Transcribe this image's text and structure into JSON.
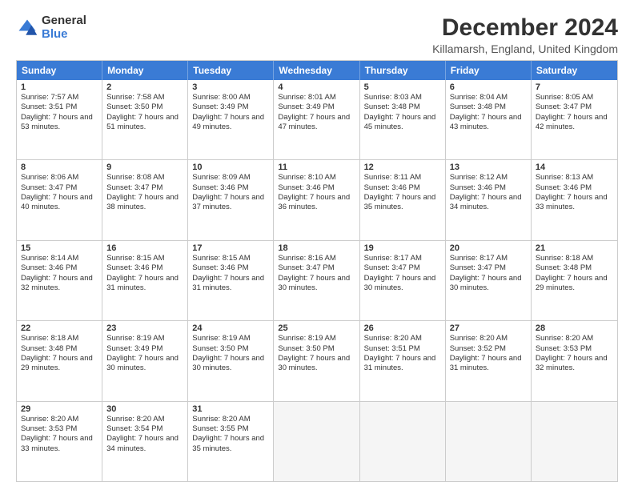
{
  "logo": {
    "general": "General",
    "blue": "Blue"
  },
  "title": "December 2024",
  "subtitle": "Killamarsh, England, United Kingdom",
  "header_days": [
    "Sunday",
    "Monday",
    "Tuesday",
    "Wednesday",
    "Thursday",
    "Friday",
    "Saturday"
  ],
  "weeks": [
    [
      {
        "day": "1",
        "sunrise": "Sunrise: 7:57 AM",
        "sunset": "Sunset: 3:51 PM",
        "daylight": "Daylight: 7 hours and 53 minutes."
      },
      {
        "day": "2",
        "sunrise": "Sunrise: 7:58 AM",
        "sunset": "Sunset: 3:50 PM",
        "daylight": "Daylight: 7 hours and 51 minutes."
      },
      {
        "day": "3",
        "sunrise": "Sunrise: 8:00 AM",
        "sunset": "Sunset: 3:49 PM",
        "daylight": "Daylight: 7 hours and 49 minutes."
      },
      {
        "day": "4",
        "sunrise": "Sunrise: 8:01 AM",
        "sunset": "Sunset: 3:49 PM",
        "daylight": "Daylight: 7 hours and 47 minutes."
      },
      {
        "day": "5",
        "sunrise": "Sunrise: 8:03 AM",
        "sunset": "Sunset: 3:48 PM",
        "daylight": "Daylight: 7 hours and 45 minutes."
      },
      {
        "day": "6",
        "sunrise": "Sunrise: 8:04 AM",
        "sunset": "Sunset: 3:48 PM",
        "daylight": "Daylight: 7 hours and 43 minutes."
      },
      {
        "day": "7",
        "sunrise": "Sunrise: 8:05 AM",
        "sunset": "Sunset: 3:47 PM",
        "daylight": "Daylight: 7 hours and 42 minutes."
      }
    ],
    [
      {
        "day": "8",
        "sunrise": "Sunrise: 8:06 AM",
        "sunset": "Sunset: 3:47 PM",
        "daylight": "Daylight: 7 hours and 40 minutes."
      },
      {
        "day": "9",
        "sunrise": "Sunrise: 8:08 AM",
        "sunset": "Sunset: 3:47 PM",
        "daylight": "Daylight: 7 hours and 38 minutes."
      },
      {
        "day": "10",
        "sunrise": "Sunrise: 8:09 AM",
        "sunset": "Sunset: 3:46 PM",
        "daylight": "Daylight: 7 hours and 37 minutes."
      },
      {
        "day": "11",
        "sunrise": "Sunrise: 8:10 AM",
        "sunset": "Sunset: 3:46 PM",
        "daylight": "Daylight: 7 hours and 36 minutes."
      },
      {
        "day": "12",
        "sunrise": "Sunrise: 8:11 AM",
        "sunset": "Sunset: 3:46 PM",
        "daylight": "Daylight: 7 hours and 35 minutes."
      },
      {
        "day": "13",
        "sunrise": "Sunrise: 8:12 AM",
        "sunset": "Sunset: 3:46 PM",
        "daylight": "Daylight: 7 hours and 34 minutes."
      },
      {
        "day": "14",
        "sunrise": "Sunrise: 8:13 AM",
        "sunset": "Sunset: 3:46 PM",
        "daylight": "Daylight: 7 hours and 33 minutes."
      }
    ],
    [
      {
        "day": "15",
        "sunrise": "Sunrise: 8:14 AM",
        "sunset": "Sunset: 3:46 PM",
        "daylight": "Daylight: 7 hours and 32 minutes."
      },
      {
        "day": "16",
        "sunrise": "Sunrise: 8:15 AM",
        "sunset": "Sunset: 3:46 PM",
        "daylight": "Daylight: 7 hours and 31 minutes."
      },
      {
        "day": "17",
        "sunrise": "Sunrise: 8:15 AM",
        "sunset": "Sunset: 3:46 PM",
        "daylight": "Daylight: 7 hours and 31 minutes."
      },
      {
        "day": "18",
        "sunrise": "Sunrise: 8:16 AM",
        "sunset": "Sunset: 3:47 PM",
        "daylight": "Daylight: 7 hours and 30 minutes."
      },
      {
        "day": "19",
        "sunrise": "Sunrise: 8:17 AM",
        "sunset": "Sunset: 3:47 PM",
        "daylight": "Daylight: 7 hours and 30 minutes."
      },
      {
        "day": "20",
        "sunrise": "Sunrise: 8:17 AM",
        "sunset": "Sunset: 3:47 PM",
        "daylight": "Daylight: 7 hours and 30 minutes."
      },
      {
        "day": "21",
        "sunrise": "Sunrise: 8:18 AM",
        "sunset": "Sunset: 3:48 PM",
        "daylight": "Daylight: 7 hours and 29 minutes."
      }
    ],
    [
      {
        "day": "22",
        "sunrise": "Sunrise: 8:18 AM",
        "sunset": "Sunset: 3:48 PM",
        "daylight": "Daylight: 7 hours and 29 minutes."
      },
      {
        "day": "23",
        "sunrise": "Sunrise: 8:19 AM",
        "sunset": "Sunset: 3:49 PM",
        "daylight": "Daylight: 7 hours and 30 minutes."
      },
      {
        "day": "24",
        "sunrise": "Sunrise: 8:19 AM",
        "sunset": "Sunset: 3:50 PM",
        "daylight": "Daylight: 7 hours and 30 minutes."
      },
      {
        "day": "25",
        "sunrise": "Sunrise: 8:19 AM",
        "sunset": "Sunset: 3:50 PM",
        "daylight": "Daylight: 7 hours and 30 minutes."
      },
      {
        "day": "26",
        "sunrise": "Sunrise: 8:20 AM",
        "sunset": "Sunset: 3:51 PM",
        "daylight": "Daylight: 7 hours and 31 minutes."
      },
      {
        "day": "27",
        "sunrise": "Sunrise: 8:20 AM",
        "sunset": "Sunset: 3:52 PM",
        "daylight": "Daylight: 7 hours and 31 minutes."
      },
      {
        "day": "28",
        "sunrise": "Sunrise: 8:20 AM",
        "sunset": "Sunset: 3:53 PM",
        "daylight": "Daylight: 7 hours and 32 minutes."
      }
    ],
    [
      {
        "day": "29",
        "sunrise": "Sunrise: 8:20 AM",
        "sunset": "Sunset: 3:53 PM",
        "daylight": "Daylight: 7 hours and 33 minutes."
      },
      {
        "day": "30",
        "sunrise": "Sunrise: 8:20 AM",
        "sunset": "Sunset: 3:54 PM",
        "daylight": "Daylight: 7 hours and 34 minutes."
      },
      {
        "day": "31",
        "sunrise": "Sunrise: 8:20 AM",
        "sunset": "Sunset: 3:55 PM",
        "daylight": "Daylight: 7 hours and 35 minutes."
      },
      null,
      null,
      null,
      null
    ]
  ]
}
